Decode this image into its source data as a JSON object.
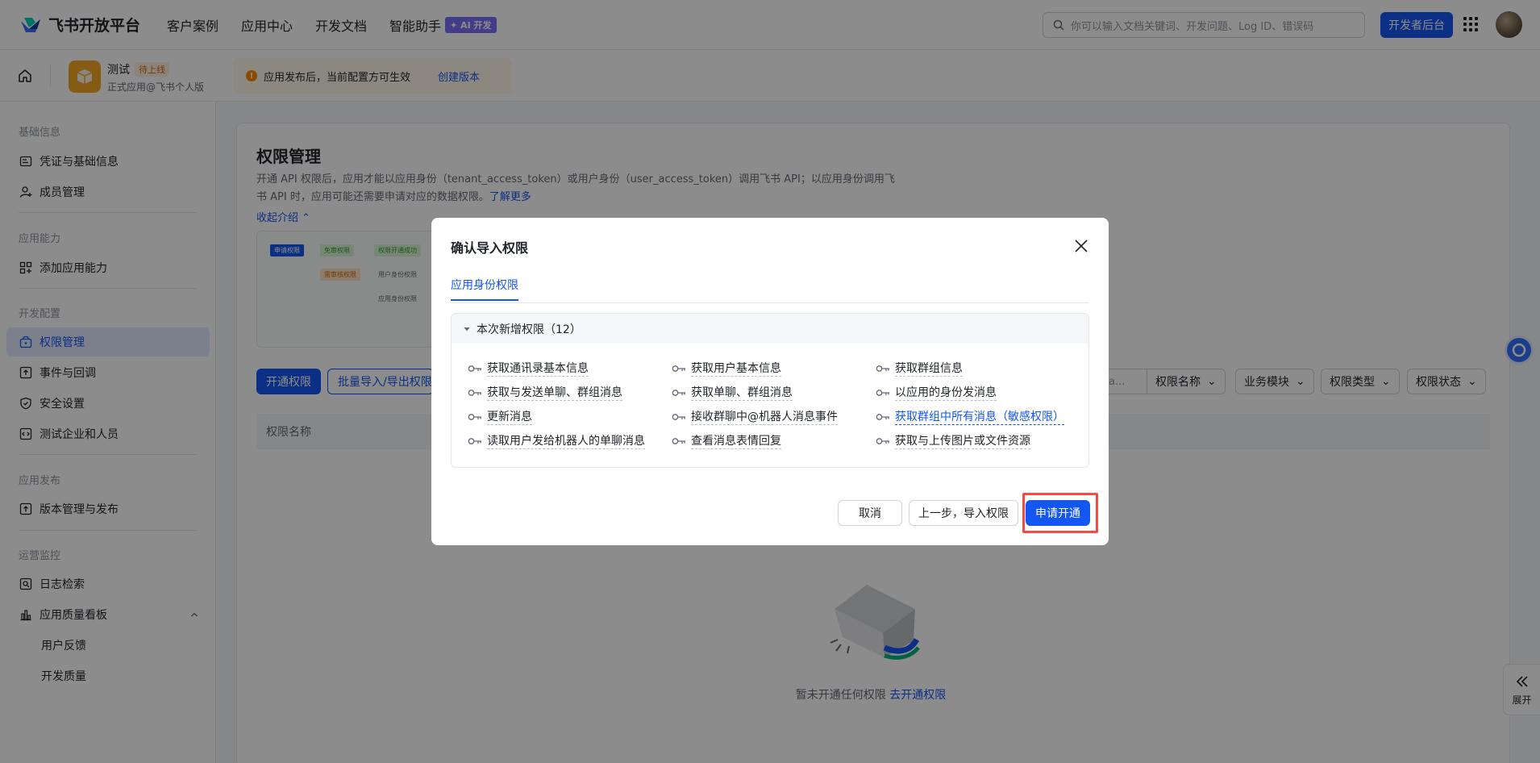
{
  "topbar": {
    "brand": "飞书开放平台",
    "nav": [
      "客户案例",
      "应用中心",
      "开发文档",
      "智能助手"
    ],
    "ai_badge": "✦ AI 开发",
    "search_placeholder": "你可以输入文档关键词、开发问题、Log ID、错误码",
    "dev_console": "开发者后台"
  },
  "appbar": {
    "app_name": "测试",
    "app_status": "待上线",
    "app_sub": "正式应用@飞书个人版",
    "notice": "应用发布后，当前配置方可生效",
    "notice_link": "创建版本"
  },
  "sidebar": {
    "sections": [
      "基础信息",
      "应用能力",
      "开发配置",
      "应用发布",
      "运营监控"
    ],
    "items": [
      "凭证与基础信息",
      "成员管理",
      "添加应用能力",
      "权限管理",
      "事件与回调",
      "安全设置",
      "测试企业和人员",
      "版本管理与发布",
      "日志检索",
      "应用质量看板",
      "用户反馈",
      "开发质量"
    ]
  },
  "main": {
    "title": "权限管理",
    "desc": "开通 API 权限后，应用才能以应用身份（tenant_access_token）或用户身份（user_access_token）调用飞书 API；以应用身份调用飞书 API 时，应用可能还需要申请对应的数据权限。",
    "learn_more": "了解更多",
    "collapse": "收起介绍",
    "flow": [
      "申请权限",
      "免审权限",
      "权限开通成功",
      "需审核权限",
      "用户身份权限",
      "应用身份权限"
    ],
    "btn_open": "开通权限",
    "btn_batch": "批量导入/导出权限",
    "filter_search": "a...",
    "filters": [
      "权限名称",
      "业务模块",
      "权限类型",
      "权限状态"
    ],
    "table_col": "权限名称",
    "empty_text": "暂未开通任何权限",
    "empty_link": "去开通权限",
    "expand": "展开"
  },
  "modal": {
    "title": "确认导入权限",
    "tab": "应用身份权限",
    "group_label": "本次新增权限（12）",
    "permissions": [
      {
        "label": "获取通讯录基本信息",
        "sensitive": false
      },
      {
        "label": "获取用户基本信息",
        "sensitive": false
      },
      {
        "label": "获取群组信息",
        "sensitive": false
      },
      {
        "label": "获取与发送单聊、群组消息",
        "sensitive": false
      },
      {
        "label": "获取单聊、群组消息",
        "sensitive": false
      },
      {
        "label": "以应用的身份发消息",
        "sensitive": false
      },
      {
        "label": "更新消息",
        "sensitive": false
      },
      {
        "label": "接收群聊中@机器人消息事件",
        "sensitive": false
      },
      {
        "label": "获取群组中所有消息（敏感权限）",
        "sensitive": true
      },
      {
        "label": "读取用户发给机器人的单聊消息",
        "sensitive": false
      },
      {
        "label": "查看消息表情回复",
        "sensitive": false
      },
      {
        "label": "获取与上传图片或文件资源",
        "sensitive": false
      }
    ],
    "cancel": "取消",
    "prev": "上一步，导入权限",
    "apply": "申请开通"
  },
  "colors": {
    "primary": "#1456f0",
    "highlight": "#f54a45",
    "warning": "#ff8800",
    "app_icon": "#f5a623"
  }
}
